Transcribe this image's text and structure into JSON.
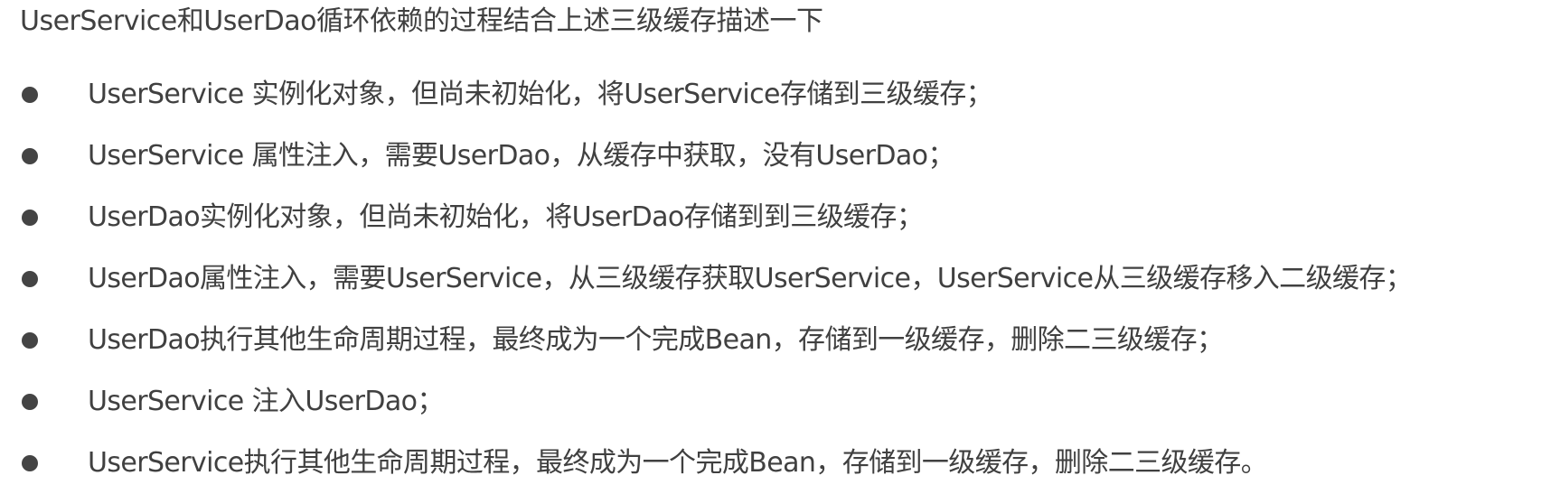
{
  "heading": "UserService和UserDao循环依赖的过程结合上述三级缓存描述一下",
  "colors": {
    "text": "#404040",
    "bullet": "#444444",
    "background": "#ffffff"
  },
  "steps": [
    {
      "text": "UserService 实例化对象，但尚未初始化，将UserService存储到三级缓存；"
    },
    {
      "text": "UserService 属性注入，需要UserDao，从缓存中获取，没有UserDao；"
    },
    {
      "text": "UserDao实例化对象，但尚未初始化，将UserDao存储到到三级缓存；"
    },
    {
      "text": "UserDao属性注入，需要UserService，从三级缓存获取UserService，UserService从三级缓存移入二级缓存；"
    },
    {
      "text": "UserDao执行其他生命周期过程，最终成为一个完成Bean，存储到一级缓存，删除二三级缓存；"
    },
    {
      "text": "UserService 注入UserDao；"
    },
    {
      "text": "UserService执行其他生命周期过程，最终成为一个完成Bean，存储到一级缓存，删除二三级缓存。"
    }
  ]
}
